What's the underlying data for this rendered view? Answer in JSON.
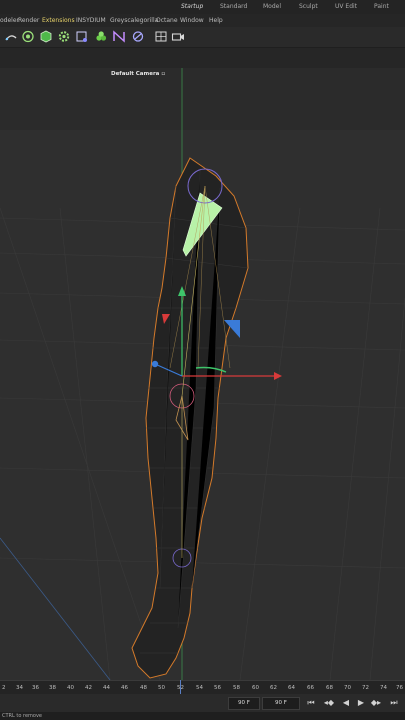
{
  "layout_tabs": [
    {
      "label": "Startup",
      "active": true
    },
    {
      "label": "Standard",
      "active": false
    },
    {
      "label": "Model",
      "active": false
    },
    {
      "label": "Sculpt",
      "active": false
    },
    {
      "label": "UV Edit",
      "active": false
    },
    {
      "label": "Paint",
      "active": false
    }
  ],
  "menu": [
    "odeler",
    "Render",
    "Extensions",
    "INSYDIUM",
    "Greyscalegorilla",
    "Octane",
    "Window",
    "Help"
  ],
  "menu_highlight": "Extensions",
  "toolbar_icons": [
    "spline-pen-icon",
    "target-icon",
    "cube-icon",
    "gear-icon",
    "box-select-icon",
    "cluster-icon",
    "deformer-icon",
    "rotate-icon",
    "grid-icon",
    "camera-icon"
  ],
  "viewport": {
    "camera_label": "Default Camera",
    "camera_icon": "camera-marker-icon"
  },
  "timeline": {
    "ticks": [
      "2",
      "34",
      "36",
      "38",
      "40",
      "42",
      "44",
      "46",
      "48",
      "50",
      "52",
      "54",
      "56",
      "58",
      "60",
      "62",
      "64",
      "66",
      "68",
      "70",
      "72",
      "74",
      "76"
    ],
    "current_frame_display": "52"
  },
  "controls": {
    "field_a": "90 F",
    "field_b": "90 F",
    "buttons": [
      "go-start-icon",
      "prev-key-icon",
      "play-back-icon",
      "play-icon",
      "next-key-icon",
      "go-end-icon"
    ]
  },
  "status": "CTRL to remove",
  "colors": {
    "accent": "#e8d36a",
    "axis_x": "#d83a3a",
    "axis_y": "#3ec46a",
    "axis_z": "#3a7bd8",
    "mesh_outline": "#d47a2a",
    "selected": "#b8f2a8"
  }
}
